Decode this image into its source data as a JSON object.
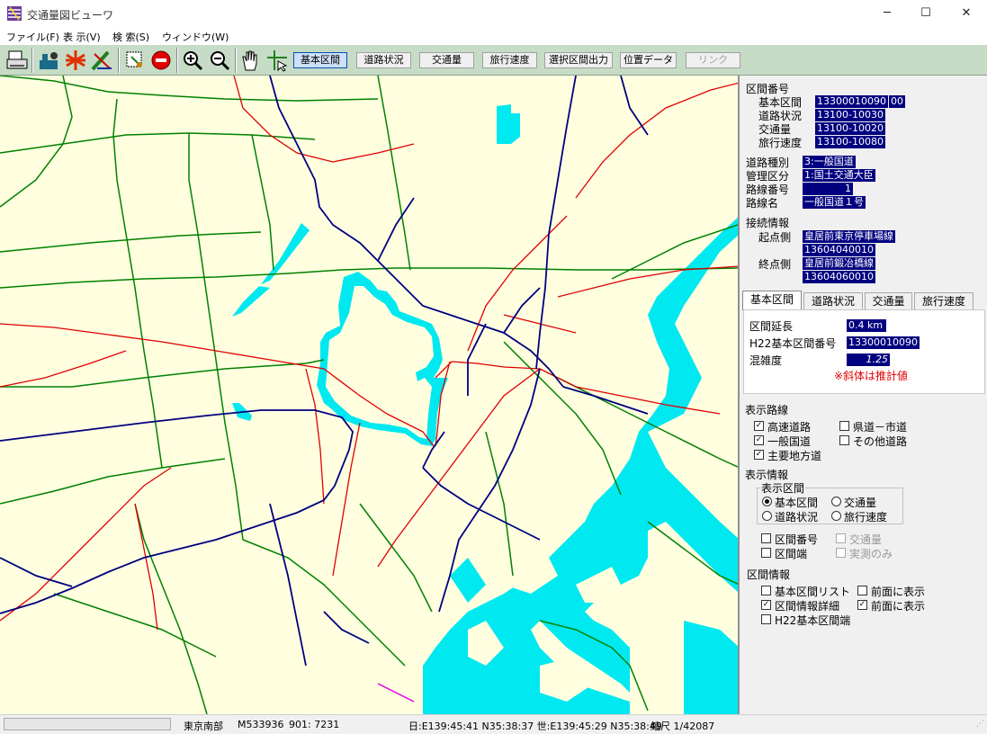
{
  "window": {
    "title": "交通量図ビューワ",
    "minimize": "─",
    "maximize": "☐",
    "close": "✕"
  },
  "menu": [
    "ファイル(F)",
    "表 示(V)",
    "検 索(S)",
    "ウィンドウ(W)"
  ],
  "toolbar": {
    "icons": [
      "print-icon",
      "section-tool-icon",
      "asterisk-icon",
      "pencil-tool-icon",
      "select-region-icon",
      "stop-icon",
      "zoom-in-icon",
      "zoom-out-icon",
      "hand-pan-icon",
      "crosshair-select-icon"
    ],
    "buttons": [
      "基本区間",
      "道路状況",
      "交通量",
      "旅行速度",
      "選択区間出力",
      "位置データ",
      "リンク"
    ]
  },
  "panel": {
    "section_number_header": "区間番号",
    "kihon_label": "基本区間",
    "kihon_value": "13300010090",
    "kihon_suffix": "00",
    "doro_label": "道路状況",
    "doro_value": "13100-10030",
    "kotsu_label": "交通量",
    "kotsu_value": "13100-10020",
    "ryoko_label": "旅行速度",
    "ryoko_value": "13100-10080",
    "road_type_label": "道路種別",
    "road_type_value": "3:一般国道",
    "admin_label": "管理区分",
    "admin_value": "1:国土交通大臣",
    "route_no_label": "路線番号",
    "route_no_value": "1",
    "route_name_label": "路線名",
    "route_name_value": "一般国道１号",
    "connection_header": "接続情報",
    "start_label": "起点側",
    "start_name": "皇居前東京停車場線",
    "start_id": "13604040010",
    "end_label": "終点側",
    "end_name": "皇居前鍛冶橋線",
    "end_id": "13604060010",
    "tabs": [
      "基本区間",
      "道路状況",
      "交通量",
      "旅行速度"
    ],
    "length_label": "区間延長",
    "length_value": "0.4 km",
    "h22_label": "H22基本区間番号",
    "h22_value": "13300010090",
    "congestion_label": "混雑度",
    "congestion_value": "1.25",
    "estimate_note": "※斜体は推計値",
    "display_routes_header": "表示路線",
    "routes": [
      {
        "label": "高速道路",
        "checked": true
      },
      {
        "label": "県道－市道",
        "checked": false
      },
      {
        "label": "一般国道",
        "checked": true
      },
      {
        "label": "その他道路",
        "checked": false
      },
      {
        "label": "主要地方道",
        "checked": true
      }
    ],
    "display_info_header": "表示情報",
    "display_section_group": "表示区間",
    "radios": [
      {
        "label": "基本区間",
        "selected": true
      },
      {
        "label": "交通量",
        "selected": false
      },
      {
        "label": "道路状況",
        "selected": false
      },
      {
        "label": "旅行速度",
        "selected": false
      }
    ],
    "opts": [
      {
        "label": "区間番号",
        "checked": false,
        "disabled": false
      },
      {
        "label": "交通量",
        "checked": false,
        "disabled": true
      },
      {
        "label": "区間端",
        "checked": false,
        "disabled": false
      },
      {
        "label": "実測のみ",
        "checked": false,
        "disabled": true
      }
    ],
    "section_info_header": "区間情報",
    "info": [
      {
        "label": "基本区間リスト",
        "checked": false
      },
      {
        "label": "前面に表示",
        "checked": false
      },
      {
        "label": "区間情報詳細",
        "checked": true
      },
      {
        "label": "前面に表示",
        "checked": true
      },
      {
        "label": "H22基本区間端",
        "checked": false
      }
    ]
  },
  "status": {
    "area": "東京南部",
    "mesh": "M533936",
    "code": "901: 7231",
    "coords": "日:E139:45:41 N35:38:37 世:E139:45:29 N35:38:49",
    "scale": "縮尺 1/42087"
  },
  "colors": {
    "map_bg": "#ffffe0",
    "water": "#00e8f0",
    "expressway": "#000080",
    "national_road": "#e00000",
    "main_road": "#008000",
    "toolbar": "#c6dcc6"
  }
}
